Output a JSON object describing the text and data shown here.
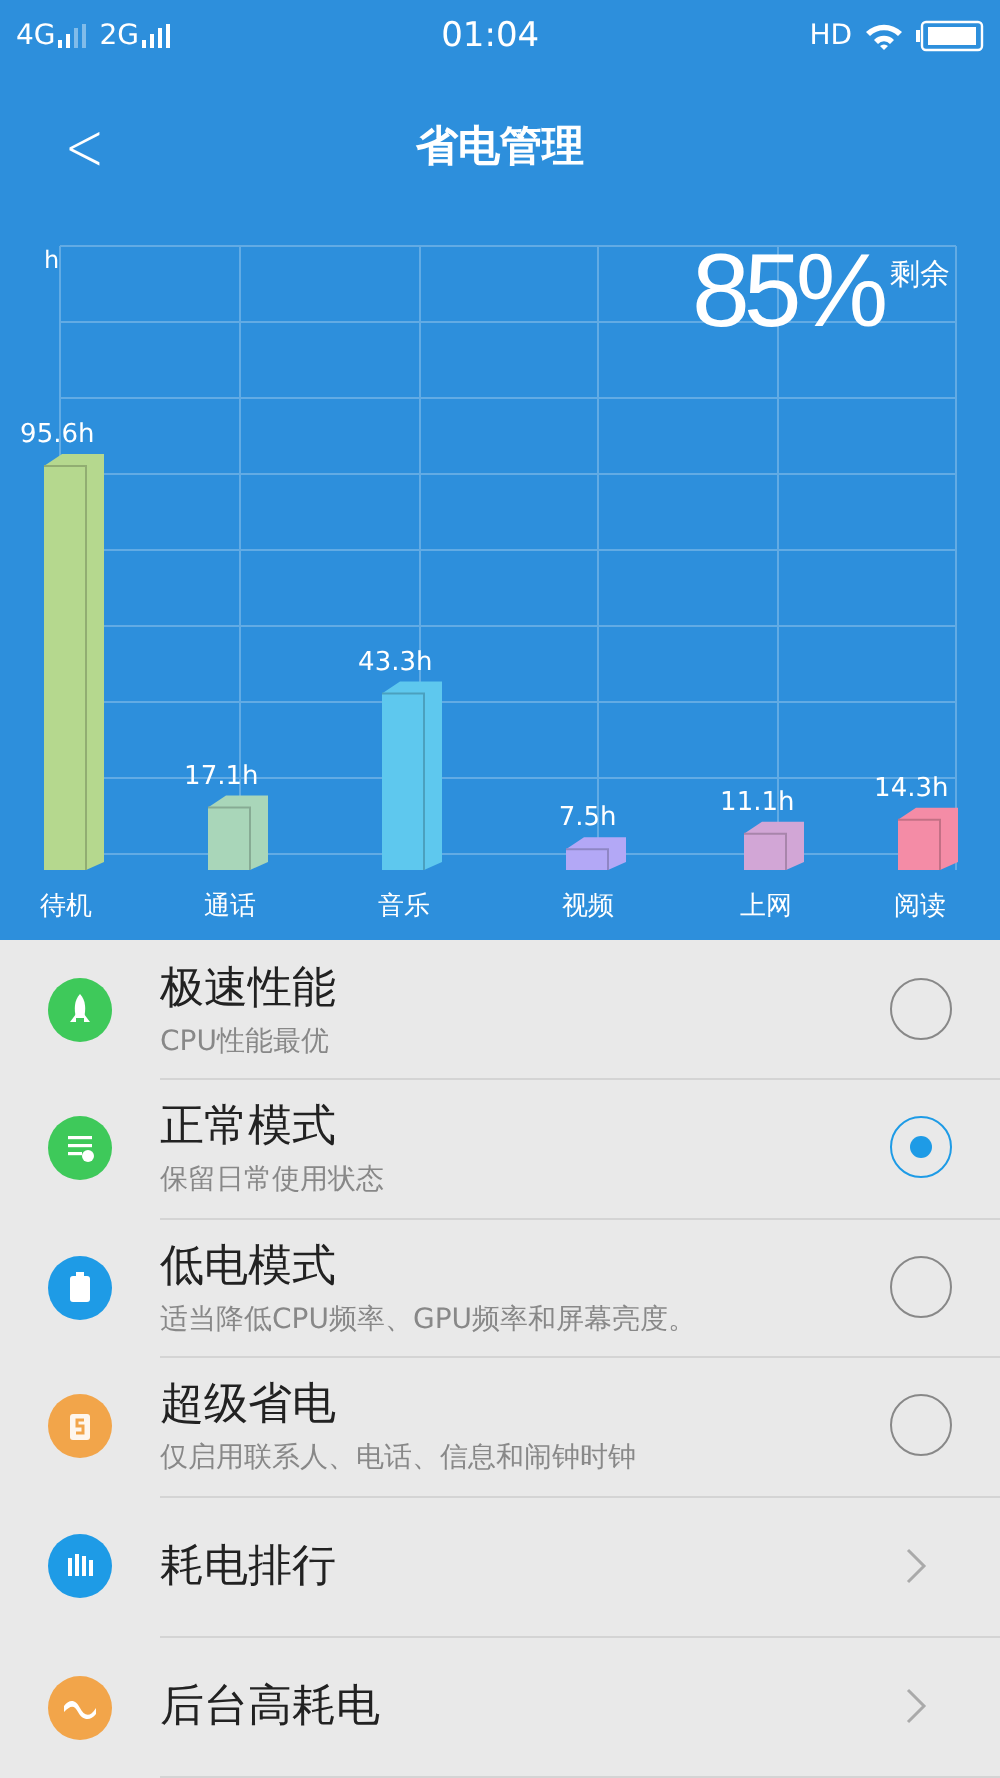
{
  "status_bar": {
    "network_1": "4G",
    "network_2": "2G",
    "time": "01:04",
    "hd": "HD"
  },
  "header": {
    "back": "<",
    "title": "省电管理"
  },
  "battery": {
    "percent": "85%",
    "suffix": "剩余"
  },
  "chart_data": {
    "type": "bar",
    "categories": [
      "待机",
      "通话",
      "音乐",
      "视频",
      "上网",
      "阅读"
    ],
    "stacked": true,
    "annotations": [
      {
        "text": "h"
      },
      {
        "text": "h"
      },
      {
        "text": "h"
      },
      {
        "text": "h"
      },
      {
        "text": "h"
      },
      {
        "text": "h"
      },
      {
        "text": "h"
      }
    ],
    "data_labels": true,
    "series": [
      {
        "color": "#b5d88e",
        "values": [
          95.6,
          null,
          null,
          null,
          null,
          null
        ]
      },
      {
        "color": "#a9d6b9",
        "values": [
          null,
          17.1,
          null,
          null,
          null,
          null
        ]
      },
      {
        "color": "#5ec8ee",
        "values": [
          null,
          null,
          43.3,
          null,
          null,
          null
        ]
      },
      {
        "color": "#b3a8f6",
        "values": [
          null,
          null,
          null,
          7.5,
          null,
          null
        ]
      },
      {
        "color": "#d2a6d6",
        "values": [
          null,
          null,
          null,
          null,
          11.1,
          null
        ]
      },
      {
        "color": "#f48ca6",
        "values": [
          null,
          null,
          null,
          null,
          null,
          14.3
        ]
      }
    ]
  },
  "options": [
    {
      "kind": "radio",
      "title": "极速性能",
      "subtitle": "CPU性能最优",
      "selected": false,
      "color": "#3ec95a"
    },
    {
      "kind": "radio",
      "title": "正常模式",
      "subtitle": "保留日常使用状态",
      "selected": true,
      "color": "#3ec95a"
    },
    {
      "kind": "radio",
      "title": "低电模式",
      "subtitle": "适当降低CPU频率、GPU频率和屏幕亮度。",
      "selected": false,
      "color": "#1e9be6"
    },
    {
      "kind": "radio",
      "title": "超级省电",
      "subtitle": "仅启用联系人、电话、信息和闹钟时钟",
      "selected": false,
      "color": "#f2a54a"
    },
    {
      "kind": "link",
      "title": "耗电排行",
      "color": "#1e9be6"
    },
    {
      "kind": "link",
      "title": "后台高耗电",
      "color": "#f2a54a"
    }
  ]
}
